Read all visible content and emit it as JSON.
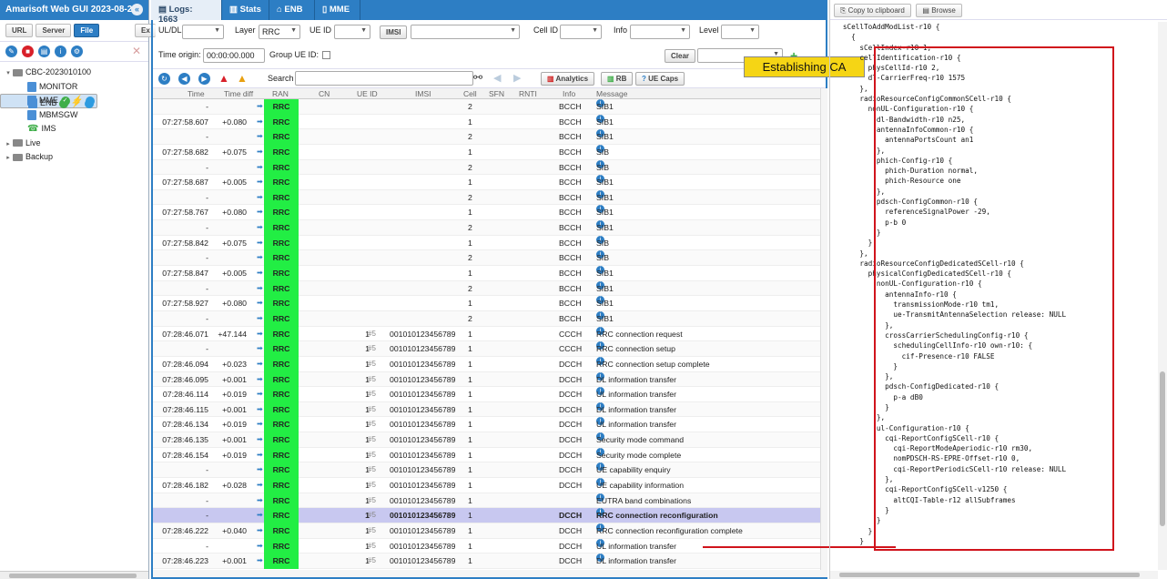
{
  "app": {
    "title": "Amarisoft Web GUI 2023-08-25",
    "collapse_icon": "«"
  },
  "left": {
    "buttons": [
      "URL",
      "Server",
      "File",
      "Ex"
    ],
    "tree": [
      {
        "label": "CBC-2023010100",
        "level": 0,
        "arrow": "▾",
        "kind": "folder"
      },
      {
        "label": "MONITOR",
        "level": 1,
        "kind": "server"
      },
      {
        "label": "ENB",
        "level": 1,
        "kind": "server",
        "selected": true,
        "status": true
      },
      {
        "label": "MME",
        "level": 1,
        "kind": "server",
        "status": true
      },
      {
        "label": "MBMSGW",
        "level": 1,
        "kind": "server"
      },
      {
        "label": "IMS",
        "level": 1,
        "kind": "phone"
      },
      {
        "label": "Live",
        "level": 0,
        "arrow": "▸",
        "kind": "folder"
      },
      {
        "label": "Backup",
        "level": 0,
        "arrow": "▸",
        "kind": "folder"
      }
    ]
  },
  "tabs": [
    {
      "label": "Logs: 1663",
      "active": true
    },
    {
      "label": "Stats"
    },
    {
      "label": "ENB"
    },
    {
      "label": "MME"
    }
  ],
  "filters": {
    "uldl_label": "UL/DL",
    "layer_label": "Layer",
    "layer_value": "RRC",
    "ueid_label": "UE ID",
    "imsi_btn": "IMSI",
    "cellid_label": "Cell ID",
    "info_label": "Info",
    "level_label": "Level",
    "time_origin_label": "Time origin:",
    "time_origin_value": "00:00:00.000",
    "group_ueid_label": "Group UE ID:",
    "clear_btn": "Clear"
  },
  "toolbar": {
    "search_label": "Search",
    "analytics": "Analytics",
    "rb": "RB",
    "uecaps": "UE Caps"
  },
  "columns": [
    "Time",
    "Time diff",
    "RAN",
    "CN",
    "UE ID",
    "IMSI",
    "Cell",
    "SFN",
    "RNTI",
    "Info",
    "Message"
  ],
  "rows": [
    {
      "time": "-",
      "diff": "",
      "ran": "RRC",
      "ue": "",
      "imsi": "",
      "cell": "2",
      "info": "BCCH",
      "msg": "SIB1"
    },
    {
      "time": "07:27:58.607",
      "diff": "+0.080",
      "ran": "RRC",
      "ue": "",
      "imsi": "",
      "cell": "1",
      "info": "BCCH",
      "msg": "SIB1"
    },
    {
      "time": "-",
      "diff": "",
      "ran": "RRC",
      "ue": "",
      "imsi": "",
      "cell": "2",
      "info": "BCCH",
      "msg": "SIB1"
    },
    {
      "time": "07:27:58.682",
      "diff": "+0.075",
      "ran": "RRC",
      "ue": "",
      "imsi": "",
      "cell": "1",
      "info": "BCCH",
      "msg": "SIB"
    },
    {
      "time": "-",
      "diff": "",
      "ran": "RRC",
      "ue": "",
      "imsi": "",
      "cell": "2",
      "info": "BCCH",
      "msg": "SIB"
    },
    {
      "time": "07:27:58.687",
      "diff": "+0.005",
      "ran": "RRC",
      "ue": "",
      "imsi": "",
      "cell": "1",
      "info": "BCCH",
      "msg": "SIB1"
    },
    {
      "time": "-",
      "diff": "",
      "ran": "RRC",
      "ue": "",
      "imsi": "",
      "cell": "2",
      "info": "BCCH",
      "msg": "SIB1"
    },
    {
      "time": "07:27:58.767",
      "diff": "+0.080",
      "ran": "RRC",
      "ue": "",
      "imsi": "",
      "cell": "1",
      "info": "BCCH",
      "msg": "SIB1"
    },
    {
      "time": "-",
      "diff": "",
      "ran": "RRC",
      "ue": "",
      "imsi": "",
      "cell": "2",
      "info": "BCCH",
      "msg": "SIB1"
    },
    {
      "time": "07:27:58.842",
      "diff": "+0.075",
      "ran": "RRC",
      "ue": "",
      "imsi": "",
      "cell": "1",
      "info": "BCCH",
      "msg": "SIB"
    },
    {
      "time": "-",
      "diff": "",
      "ran": "RRC",
      "ue": "",
      "imsi": "",
      "cell": "2",
      "info": "BCCH",
      "msg": "SIB"
    },
    {
      "time": "07:27:58.847",
      "diff": "+0.005",
      "ran": "RRC",
      "ue": "",
      "imsi": "",
      "cell": "1",
      "info": "BCCH",
      "msg": "SIB1"
    },
    {
      "time": "-",
      "diff": "",
      "ran": "RRC",
      "ue": "",
      "imsi": "",
      "cell": "2",
      "info": "BCCH",
      "msg": "SIB1"
    },
    {
      "time": "07:27:58.927",
      "diff": "+0.080",
      "ran": "RRC",
      "ue": "",
      "imsi": "",
      "cell": "1",
      "info": "BCCH",
      "msg": "SIB1"
    },
    {
      "time": "-",
      "diff": "",
      "ran": "RRC",
      "ue": "",
      "imsi": "",
      "cell": "2",
      "info": "BCCH",
      "msg": "SIB1"
    },
    {
      "time": "07:28:46.071",
      "diff": "+47.144",
      "ran": "RRC",
      "ue": "1",
      "imsi": "001010123456789",
      "cell": "1",
      "info": "CCCH",
      "msg": "RRC connection request"
    },
    {
      "time": "-",
      "diff": "",
      "ran": "RRC",
      "ue": "1",
      "imsi": "001010123456789",
      "cell": "1",
      "info": "CCCH",
      "msg": "RRC connection setup"
    },
    {
      "time": "07:28:46.094",
      "diff": "+0.023",
      "ran": "RRC",
      "ue": "1",
      "imsi": "001010123456789",
      "cell": "1",
      "info": "DCCH",
      "msg": "RRC connection setup complete"
    },
    {
      "time": "07:28:46.095",
      "diff": "+0.001",
      "ran": "RRC",
      "ue": "1",
      "imsi": "001010123456789",
      "cell": "1",
      "info": "DCCH",
      "msg": "DL information transfer"
    },
    {
      "time": "07:28:46.114",
      "diff": "+0.019",
      "ran": "RRC",
      "ue": "1",
      "imsi": "001010123456789",
      "cell": "1",
      "info": "DCCH",
      "msg": "UL information transfer"
    },
    {
      "time": "07:28:46.115",
      "diff": "+0.001",
      "ran": "RRC",
      "ue": "1",
      "imsi": "001010123456789",
      "cell": "1",
      "info": "DCCH",
      "msg": "DL information transfer"
    },
    {
      "time": "07:28:46.134",
      "diff": "+0.019",
      "ran": "RRC",
      "ue": "1",
      "imsi": "001010123456789",
      "cell": "1",
      "info": "DCCH",
      "msg": "UL information transfer"
    },
    {
      "time": "07:28:46.135",
      "diff": "+0.001",
      "ran": "RRC",
      "ue": "1",
      "imsi": "001010123456789",
      "cell": "1",
      "info": "DCCH",
      "msg": "Security mode command"
    },
    {
      "time": "07:28:46.154",
      "diff": "+0.019",
      "ran": "RRC",
      "ue": "1",
      "imsi": "001010123456789",
      "cell": "1",
      "info": "DCCH",
      "msg": "Security mode complete"
    },
    {
      "time": "-",
      "diff": "",
      "ran": "RRC",
      "ue": "1",
      "imsi": "001010123456789",
      "cell": "1",
      "info": "DCCH",
      "msg": "UE capability enquiry"
    },
    {
      "time": "07:28:46.182",
      "diff": "+0.028",
      "ran": "RRC",
      "ue": "1",
      "imsi": "001010123456789",
      "cell": "1",
      "info": "DCCH",
      "msg": "UE capability information"
    },
    {
      "time": "-",
      "diff": "",
      "ran": "RRC",
      "ue": "1",
      "imsi": "001010123456789",
      "cell": "1",
      "info": "",
      "msg": "EUTRA band combinations"
    },
    {
      "time": "-",
      "diff": "",
      "ran": "RRC",
      "ue": "1",
      "imsi": "001010123456789",
      "cell": "1",
      "info": "DCCH",
      "msg": "RRC connection reconfiguration",
      "highlight": true
    },
    {
      "time": "07:28:46.222",
      "diff": "+0.040",
      "ran": "RRC",
      "ue": "1",
      "imsi": "001010123456789",
      "cell": "1",
      "info": "DCCH",
      "msg": "RRC connection reconfiguration complete"
    },
    {
      "time": "-",
      "diff": "",
      "ran": "RRC",
      "ue": "1",
      "imsi": "001010123456789",
      "cell": "1",
      "info": "DCCH",
      "msg": "UL information transfer"
    },
    {
      "time": "07:28:46.223",
      "diff": "+0.001",
      "ran": "RRC",
      "ue": "1",
      "imsi": "001010123456789",
      "cell": "1",
      "info": "DCCH",
      "msg": "DL information transfer"
    }
  ],
  "ue_hash": "#5",
  "right": {
    "copy_btn": "Copy to clipboard",
    "browse_btn": "Browse"
  },
  "callout": "Establishing CA",
  "code": "   sCellToAddModList-r10 {\n     {\n       sCellIndex-r10 1,\n       cellIdentification-r10 {\n         physCellId-r10 2,\n         dl-CarrierFreq-r10 1575\n       },\n       radioResourceConfigCommonSCell-r10 {\n         nonUL-Configuration-r10 {\n           dl-Bandwidth-r10 n25,\n           antennaInfoCommon-r10 {\n             antennaPortsCount an1\n           },\n           phich-Config-r10 {\n             phich-Duration normal,\n             phich-Resource one\n           },\n           pdsch-ConfigCommon-r10 {\n             referenceSignalPower -29,\n             p-b 0\n           }\n         }\n       },\n       radioResourceConfigDedicatedSCell-r10 {\n         physicalConfigDedicatedSCell-r10 {\n           nonUL-Configuration-r10 {\n             antennaInfo-r10 {\n               transmissionMode-r10 tm1,\n               ue-TransmitAntennaSelection release: NULL\n             },\n             crossCarrierSchedulingConfig-r10 {\n               schedulingCellInfo-r10 own-r10: {\n                 cif-Presence-r10 FALSE\n               }\n             },\n             pdsch-ConfigDedicated-r10 {\n               p-a dB0\n             }\n           },\n           ul-Configuration-r10 {\n             cqi-ReportConfigSCell-r10 {\n               cqi-ReportModeAperiodic-r10 rm30,\n               nomPDSCH-RS-EPRE-Offset-r10 0,\n               cqi-ReportPeriodicSCell-r10 release: NULL\n             },\n             cqi-ReportConfigSCell-v1250 {\n               altCQI-Table-r12 allSubframes\n             }\n           }\n         }\n       }"
}
